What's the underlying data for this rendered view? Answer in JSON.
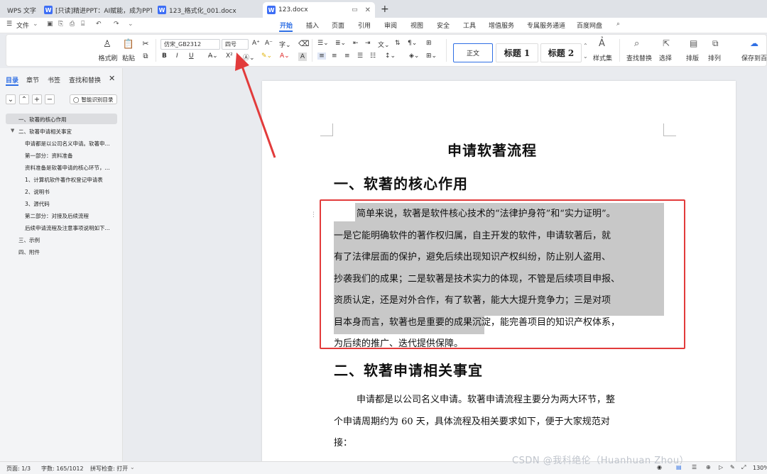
{
  "tabs": [
    {
      "label": "WPS 文字"
    },
    {
      "label": "[只读]精进PPT：AI赋能，成为PPT高"
    },
    {
      "label": "123_格式化_001.docx"
    },
    {
      "label": "123.docx"
    }
  ],
  "add_tab": "+",
  "file_menu": "文件",
  "menu": [
    "开始",
    "插入",
    "页面",
    "引用",
    "审阅",
    "视图",
    "安全",
    "工具",
    "增值服务",
    "专属服务通道",
    "百度网盘"
  ],
  "toolbar": {
    "format_painter": "格式刷",
    "paste": "粘贴",
    "font": "仿宋_GB2312",
    "size": "四号",
    "bold": "B",
    "italic": "I",
    "underline": "U",
    "superscript": "X²",
    "styles": [
      "正文",
      "标题 1",
      "标题 2"
    ],
    "style_set": "样式集",
    "find_replace": "查找替换",
    "select": "选择",
    "layout": "排版",
    "arrange": "排列",
    "save_to_baidu": "保存到百度"
  },
  "sidebar": {
    "tabs": [
      "目录",
      "章节",
      "书签",
      "查找和替换"
    ],
    "smart_toc": "智能识别目录",
    "items": [
      "一、软著的核心作用",
      "二、软著申请相关事宜",
      "申请都是以公司名义申请。软著申...",
      "第一部分：资料准备",
      "资料准备是软著申请的核心环节，...",
      "1、计算机软件著作权登记申请表",
      "2、说明书",
      "3、源代码",
      "第二部分：对接及后续流程",
      "后续申请流程及注意事项说明如下...",
      "三、示例",
      "四、附件"
    ]
  },
  "doc": {
    "title": "申请软著流程",
    "h1": "一、软著的核心作用",
    "p1": [
      "简单来说，软著是软件核心技术的“法律护身符”和“实力证明”。",
      "一是它能明确软件的著作权归属，自主开发的软件，申请软著后，就",
      "有了法律层面的保护，避免后续出现知识产权纠纷，防止别人盗用、",
      "抄袭我们的成果；二是软著是技术实力的体现，不管是后续项目申报、",
      "资质认定，还是对外合作，有了软著，能大大提升竞争力；三是对项",
      "目本身而言，软著也是重要的成果沉淀，能完善项目的知识产权体系，",
      "为后续的推广、迭代提供保障。"
    ],
    "h2": "二、软著申请相关事宜",
    "p2": [
      "申请都是以公司名义申请。软著申请流程主要分为两大环节，整",
      "个申请周期约为 60 天，具体流程及相关要求如下，便于大家规范对",
      "接："
    ]
  },
  "status": {
    "page": "页面: 1/3",
    "words": "字数: 165/1012",
    "spell": "拼写检查: 打开",
    "zoom": "130%"
  },
  "watermark": "CSDN @我科绝伦（Huanhuan Zhou）"
}
